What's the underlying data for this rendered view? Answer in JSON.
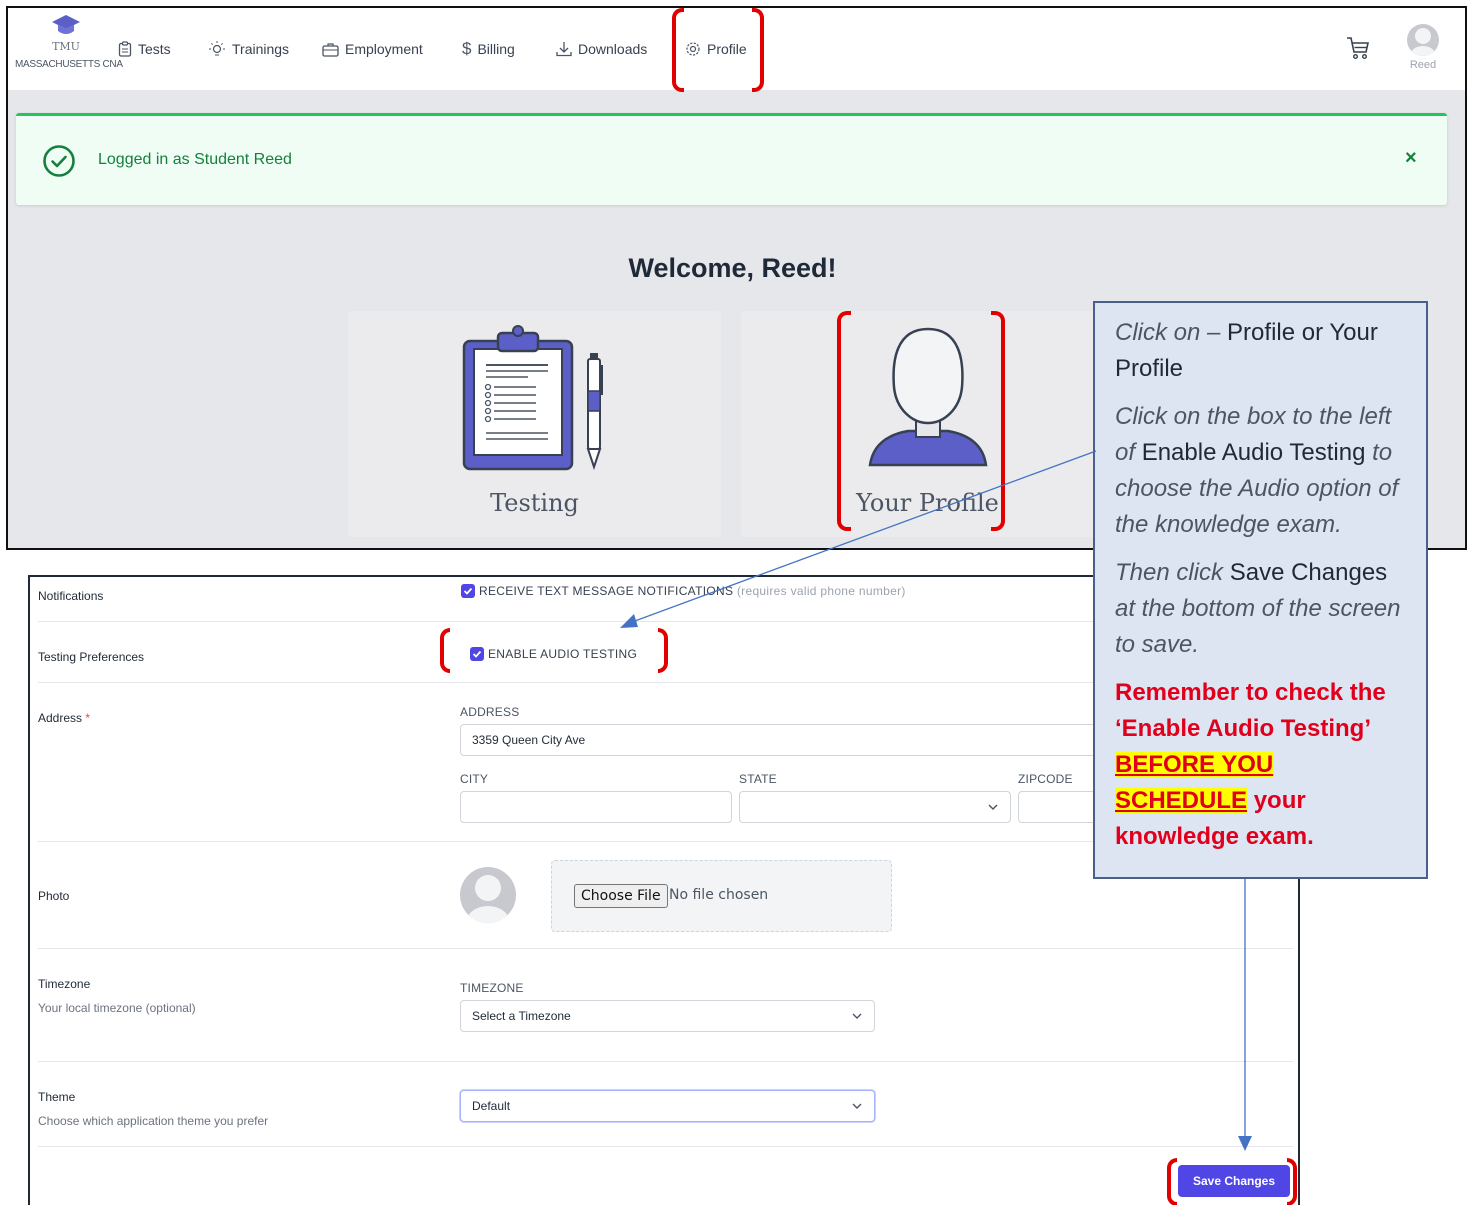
{
  "navbar": {
    "brand_name": "TMU",
    "brand_subtitle": "MASSACHUSETTS CNA",
    "items": [
      {
        "label": "Tests",
        "icon": "clipboard-icon"
      },
      {
        "label": "Trainings",
        "icon": "lightbulb-icon"
      },
      {
        "label": "Employment",
        "icon": "briefcase-icon"
      },
      {
        "label": "Billing",
        "icon": "dollar-icon"
      },
      {
        "label": "Downloads",
        "icon": "download-icon"
      },
      {
        "label": "Profile",
        "icon": "gear-icon"
      }
    ],
    "user_name": "Reed"
  },
  "alert": {
    "message": "Logged in as Student Reed",
    "close": "×",
    "color": "#22c55e"
  },
  "welcome": {
    "heading": "Welcome, Reed!",
    "tiles": [
      {
        "label": "Testing"
      },
      {
        "label": "Your Profile"
      }
    ]
  },
  "form": {
    "notifications": {
      "label": "Notifications",
      "checkbox_label": "RECEIVE TEXT MESSAGE NOTIFICATIONS",
      "checkbox_hint": "(requires valid phone number)",
      "checked": true
    },
    "testing_preferences": {
      "label": "Testing Preferences",
      "checkbox_label": "ENABLE AUDIO TESTING",
      "checked": true
    },
    "address": {
      "label": "Address",
      "required_mark": "*",
      "address_label": "ADDRESS",
      "address_value": "3359 Queen City Ave",
      "city_label": "CITY",
      "city_value": "",
      "state_label": "STATE",
      "state_value": "",
      "zip_label": "ZIPCODE",
      "zip_value": ""
    },
    "photo": {
      "label": "Photo",
      "choose_button": "Choose File",
      "no_file": "No file chosen"
    },
    "timezone": {
      "label": "Timezone",
      "sublabel": "Your local timezone (optional)",
      "field_label": "TIMEZONE",
      "placeholder": "Select a Timezone"
    },
    "theme": {
      "label": "Theme",
      "sublabel": "Choose which application theme you prefer",
      "value": "Default"
    },
    "save_button": "Save Changes",
    "accent_color": "#4f46e5"
  },
  "callout": {
    "p1_italic": "Click on –",
    "p1_plain": "Profile or Your Profile",
    "p2_italic_a": "Click on the box to the left of",
    "p2_plain": "Enable Audio Testing",
    "p2_italic_b": "to choose the Audio option of the knowledge exam.",
    "p3_italic_a": "Then click",
    "p3_plain": "Save Changes",
    "p3_italic_b": "at the bottom of the screen to save.",
    "warn_a": "Remember to check the ‘Enable Audio Testing’",
    "warn_highlight": "BEFORE YOU SCHEDULE",
    "warn_b": "your knowledge exam.",
    "warning_color": "#e0001b",
    "highlight_color": "#ffff00"
  }
}
